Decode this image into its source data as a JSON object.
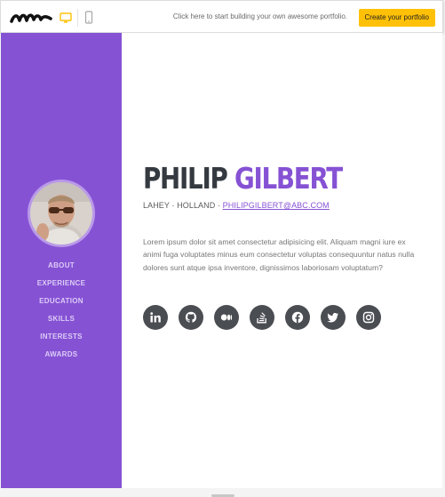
{
  "toolbar": {
    "logo_icon": "brush-stroke-logo-icon",
    "desktop_icon": "desktop-icon",
    "mobile_icon": "mobile-icon",
    "promo_text": "Click here to start building your own awesome portfolio.",
    "cta_label": "Create your portfolio",
    "accent_color": "#ffc107"
  },
  "sidebar": {
    "background_color": "#8652d4",
    "avatar_icon": "profile-photo",
    "nav_items": [
      {
        "label": "ABOUT"
      },
      {
        "label": "EXPERIENCE"
      },
      {
        "label": "EDUCATION"
      },
      {
        "label": "SKILLS"
      },
      {
        "label": "INTERESTS"
      },
      {
        "label": "AWARDS"
      }
    ]
  },
  "profile": {
    "first_name": "PHILIP",
    "last_name": "GILBERT",
    "location": "LAHEY · HOLLAND ·",
    "email": "PHILIPGILBERT@ABC.COM",
    "bio": "Lorem ipsum dolor sit amet consectetur adipisicing elit. Aliquam magni iure ex animi fuga voluptates minus eum consectetur voluptas consequuntur natus nulla dolores sunt atque ipsa inventore, dignissimos laboriosam voluptatum?",
    "socials": [
      {
        "icon": "linkedin-icon"
      },
      {
        "icon": "github-icon"
      },
      {
        "icon": "medium-icon"
      },
      {
        "icon": "stackoverflow-icon"
      },
      {
        "icon": "facebook-icon"
      },
      {
        "icon": "twitter-icon"
      },
      {
        "icon": "instagram-icon"
      }
    ]
  }
}
